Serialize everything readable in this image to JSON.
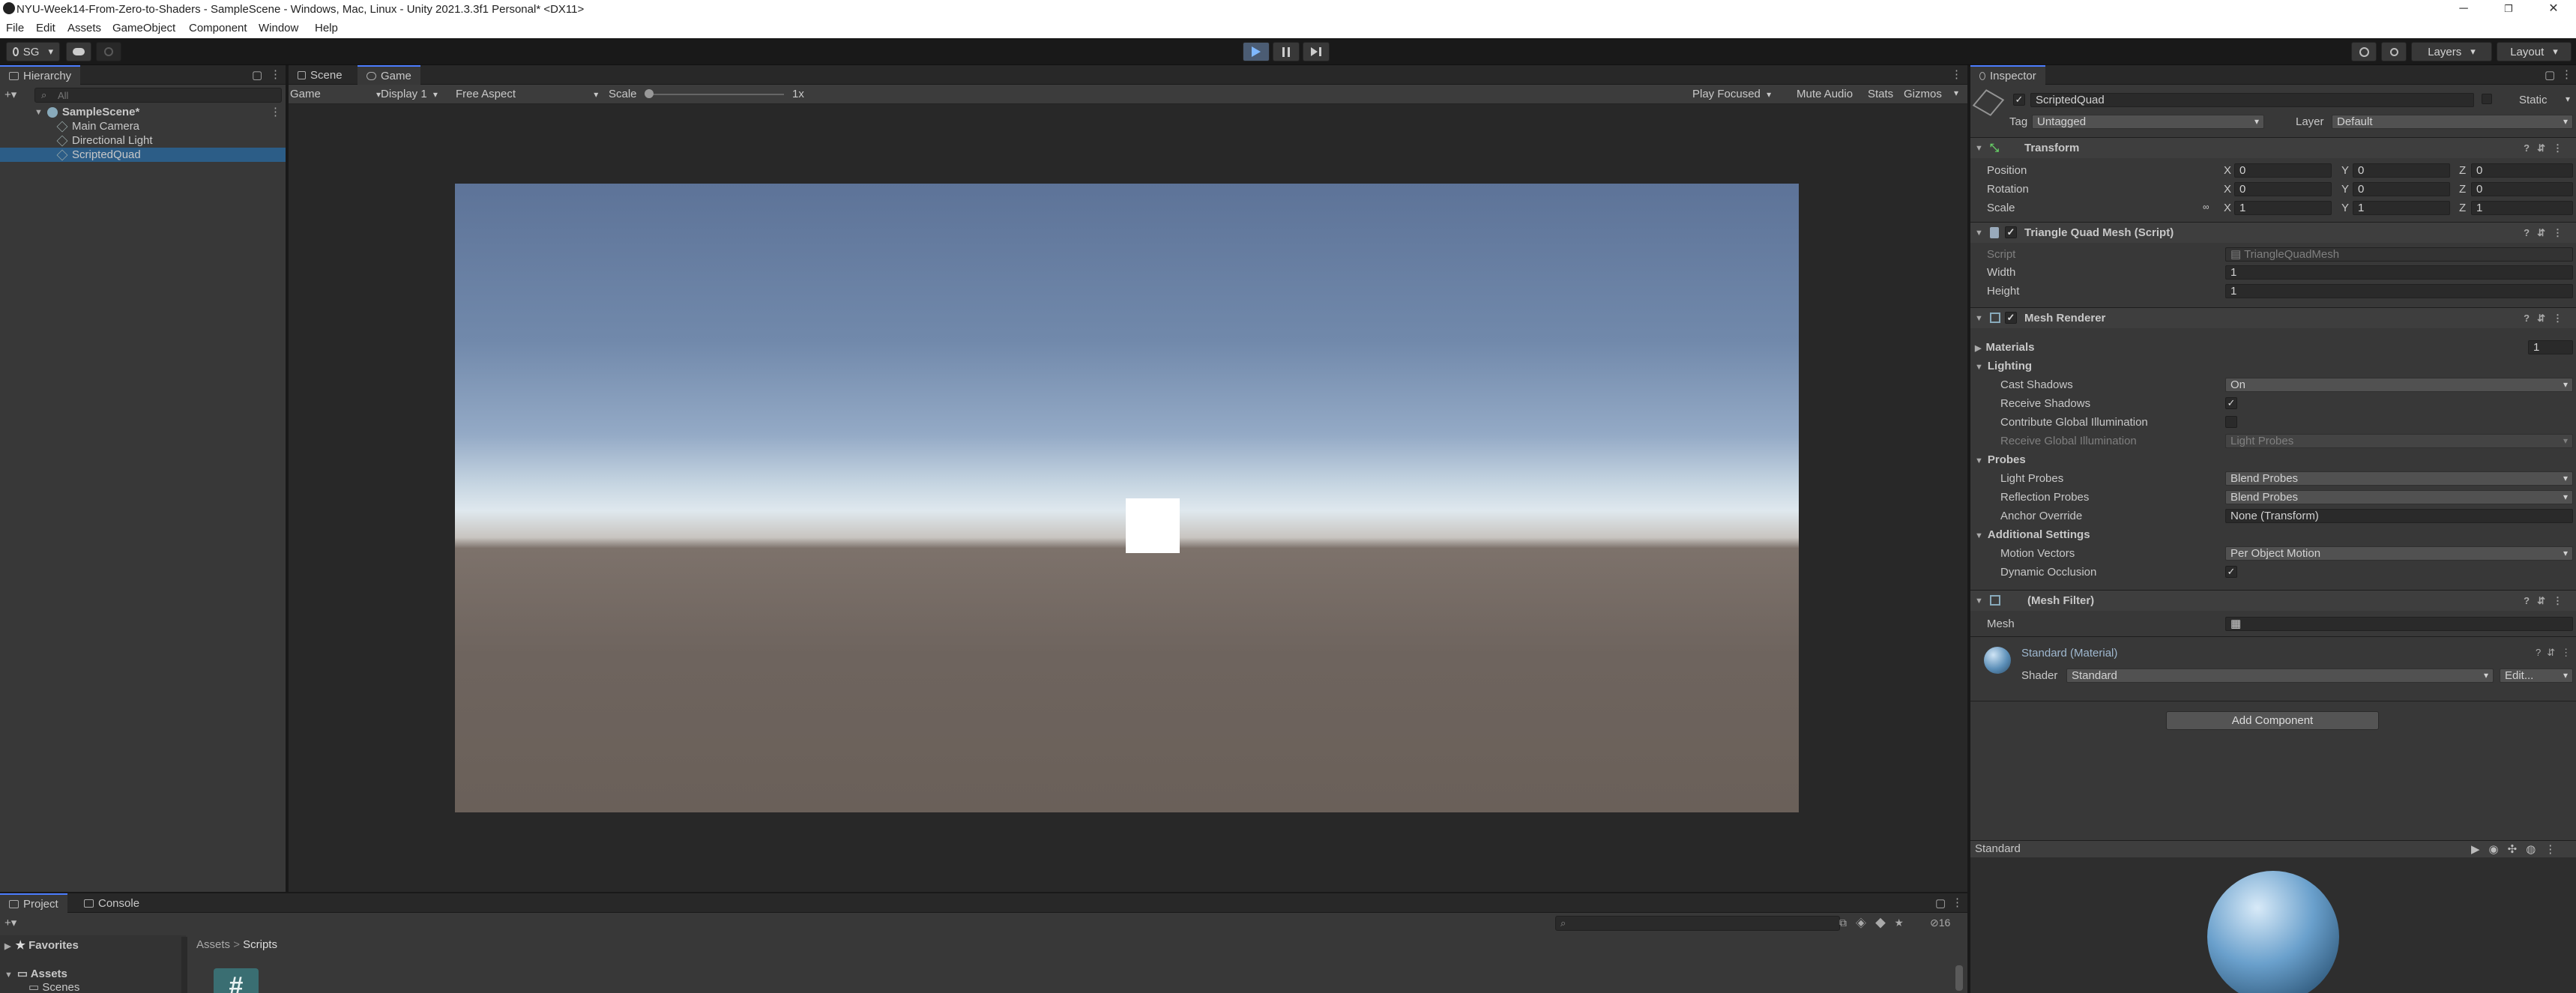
{
  "window": {
    "title": "NYU-Week14-From-Zero-to-Shaders - SampleScene - Windows, Mac, Linux - Unity 2021.3.3f1 Personal* <DX11>",
    "controls": [
      "─",
      "❐",
      "✕"
    ]
  },
  "menu": [
    "File",
    "Edit",
    "Assets",
    "GameObject",
    "Component",
    "Window",
    "Help"
  ],
  "toolbar": {
    "account": "SG",
    "layers": "Layers",
    "layout": "Layout",
    "play_active": true
  },
  "hierarchy": {
    "tab": "Hierarchy",
    "search_placeholder": "All",
    "scene": "SampleScene*",
    "items": [
      "Main Camera",
      "Directional Light",
      "ScriptedQuad"
    ],
    "selected": "ScriptedQuad"
  },
  "game": {
    "tabs": [
      "Scene",
      "Game"
    ],
    "active_tab": "Game",
    "view_mode": "Game",
    "display": "Display 1",
    "aspect": "Free Aspect",
    "scale_label": "Scale",
    "scale_value": "1x",
    "play_focused": "Play Focused",
    "mute_audio": "Mute Audio",
    "stats": "Stats",
    "gizmos": "Gizmos"
  },
  "inspector": {
    "tab": "Inspector",
    "object_name": "ScriptedQuad",
    "static_label": "Static",
    "tag_label": "Tag",
    "tag_value": "Untagged",
    "layer_label": "Layer",
    "layer_value": "Default",
    "transform": {
      "title": "Transform",
      "position_label": "Position",
      "rotation_label": "Rotation",
      "scale_label": "Scale",
      "axis": [
        "X",
        "Y",
        "Z"
      ],
      "position": [
        "0",
        "0",
        "0"
      ],
      "rotation": [
        "0",
        "0",
        "0"
      ],
      "scale": [
        "1",
        "1",
        "1"
      ]
    },
    "script": {
      "title": "Triangle Quad Mesh (Script)",
      "script_label": "Script",
      "script_value": "TriangleQuadMesh",
      "width_label": "Width",
      "width_value": "1",
      "height_label": "Height",
      "height_value": "1"
    },
    "mesh_renderer": {
      "title": "Mesh Renderer",
      "materials_label": "Materials",
      "materials_count": "1",
      "lighting": "Lighting",
      "cast_shadows_label": "Cast Shadows",
      "cast_shadows_value": "On",
      "receive_shadows_label": "Receive Shadows",
      "contribute_gi_label": "Contribute Global Illumination",
      "receive_gi_label": "Receive Global Illumination",
      "receive_gi_value": "Light Probes",
      "probes": "Probes",
      "light_probes_label": "Light Probes",
      "light_probes_value": "Blend Probes",
      "reflection_probes_label": "Reflection Probes",
      "reflection_probes_value": "Blend Probes",
      "anchor_override_label": "Anchor Override",
      "anchor_override_value": "None (Transform)",
      "additional": "Additional Settings",
      "motion_vectors_label": "Motion Vectors",
      "motion_vectors_value": "Per Object Motion",
      "dynamic_occlusion_label": "Dynamic Occlusion"
    },
    "mesh_filter": {
      "title": "(Mesh Filter)",
      "mesh_label": "Mesh"
    },
    "material": {
      "title": "Standard (Material)",
      "shader_label": "Shader",
      "shader_value": "Standard",
      "edit": "Edit..."
    },
    "add_component": "Add Component",
    "preview_title": "Standard"
  },
  "project": {
    "tabs": [
      "Project",
      "Console"
    ],
    "favorites": "Favorites",
    "assets": "Assets",
    "scenes": "Scenes",
    "breadcrumb": [
      "Assets",
      "Scripts"
    ],
    "hidden_count": "16"
  }
}
